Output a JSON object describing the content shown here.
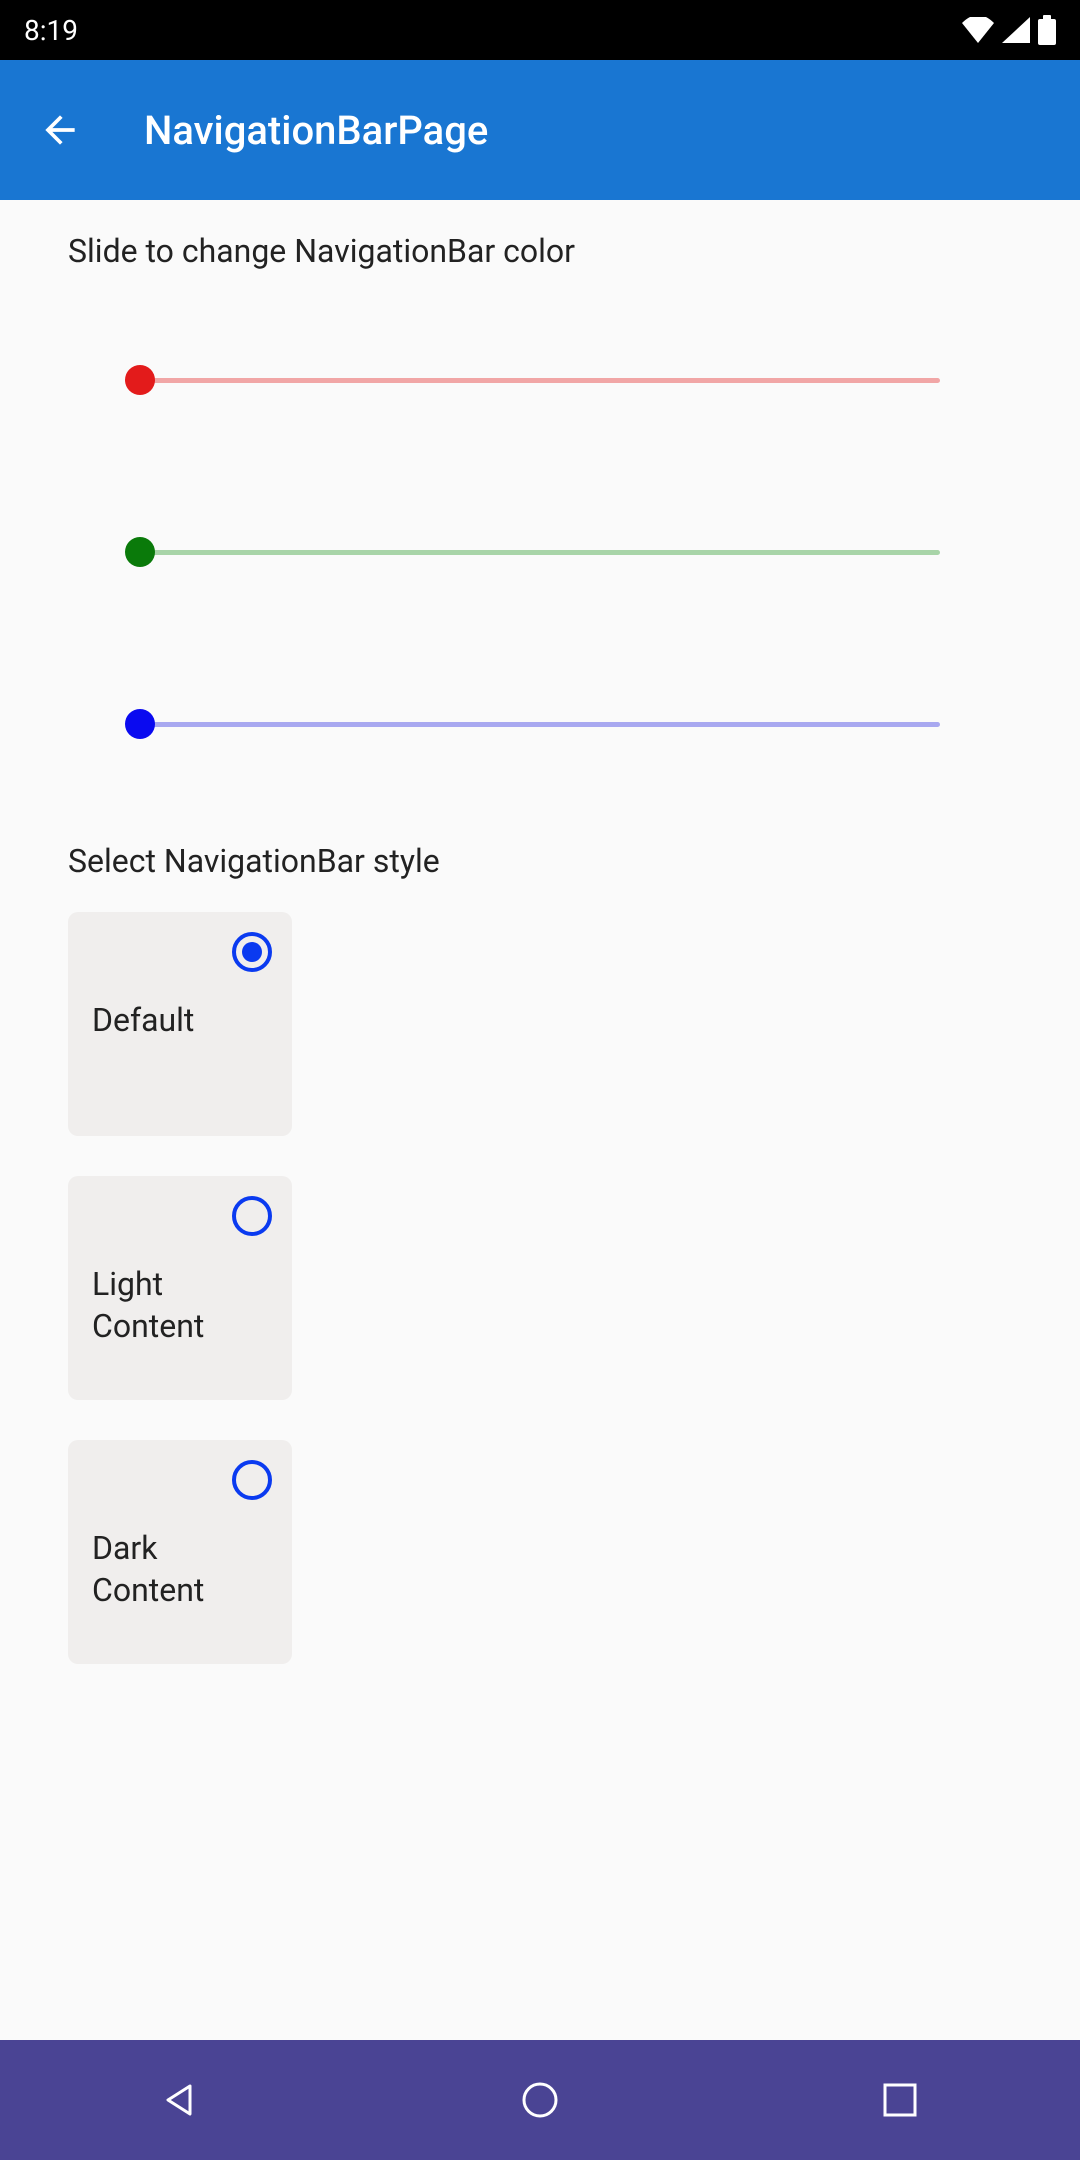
{
  "status": {
    "time": "8:19"
  },
  "appbar": {
    "title": "NavigationBarPage"
  },
  "sliders": {
    "heading": "Slide to change NavigationBar color",
    "red_value": 0,
    "green_value": 0,
    "blue_value": 0
  },
  "style": {
    "heading": "Select NavigationBar style",
    "options": [
      {
        "label": "Default",
        "selected": true
      },
      {
        "label": "Light Content",
        "selected": false
      },
      {
        "label": "Dark Content",
        "selected": false
      }
    ]
  },
  "colors": {
    "appbar": "#1976D2",
    "navbar": "#4a4494",
    "radio_accent": "#0a3af0"
  }
}
